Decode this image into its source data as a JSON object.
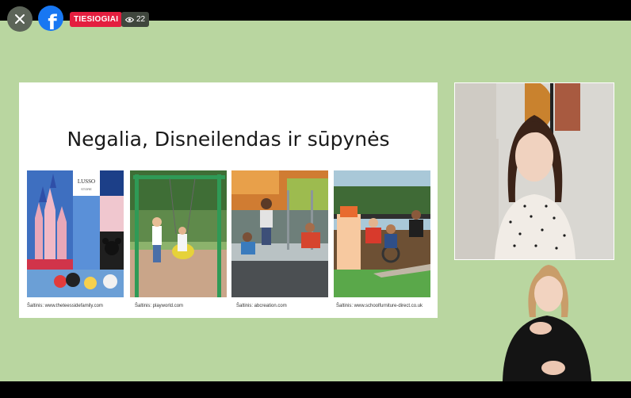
{
  "header": {
    "live_label": "TIESIOGIAI",
    "viewer_count": "22",
    "icons": {
      "close": "close-icon",
      "facebook": "facebook-logo",
      "viewers": "eye-icon"
    }
  },
  "slide": {
    "title": "Negalia, Disneilendas ir sūpynės",
    "sources": [
      "Šaltinis: www.theteessidefamily.com",
      "Šaltinis: playworld.com",
      "Šaltinis: abcreation.com",
      "Šaltinis: www.schoolfurniture-direct.co.uk"
    ],
    "photo_logo_text": "LUSSO",
    "photo_logo_sub": "STORE"
  },
  "colors": {
    "stage": "#b9d6a0",
    "live": "#e41e3f",
    "facebook": "#1877f2"
  }
}
